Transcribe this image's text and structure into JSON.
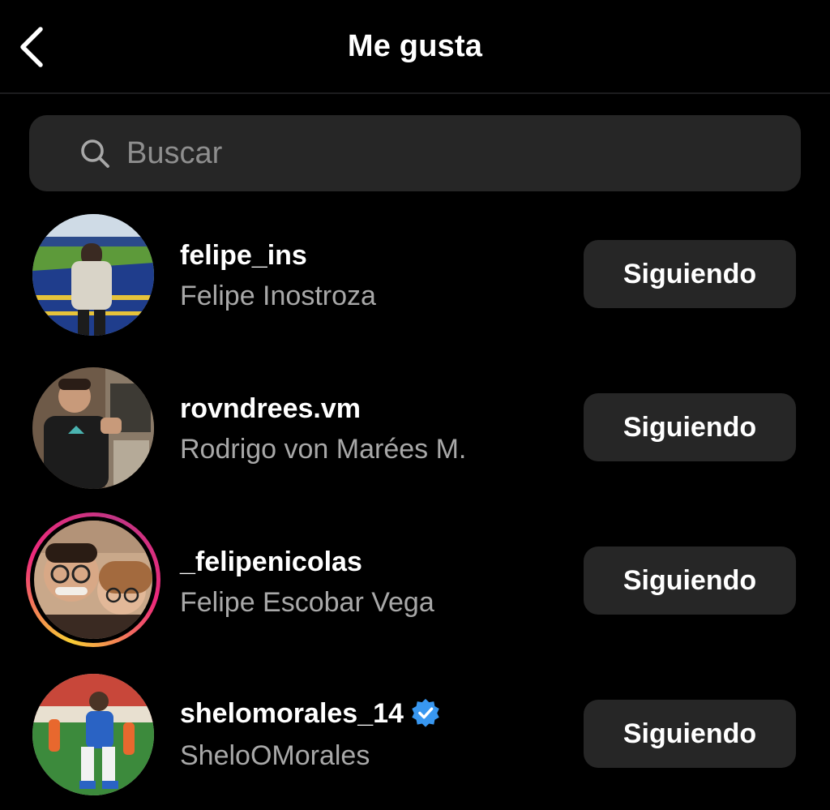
{
  "header": {
    "title": "Me gusta",
    "back_icon": "chevron-left-icon"
  },
  "search": {
    "placeholder": "Buscar",
    "value": "",
    "icon": "search-icon"
  },
  "colors": {
    "background": "#000000",
    "surface": "#262626",
    "secondary_text": "#a8a8a8",
    "verified": "#3897f0",
    "story_ring_start": "#f9ce34",
    "story_ring_mid": "#ee2a7b",
    "story_ring_end": "#6228d7"
  },
  "likes": [
    {
      "username": "felipe_ins",
      "full_name": "Felipe Inostroza",
      "verified": false,
      "story_ring": false,
      "button_label": "Siguiendo"
    },
    {
      "username": "rovndrees.vm",
      "full_name": "Rodrigo von Marées M.",
      "verified": false,
      "story_ring": false,
      "button_label": "Siguiendo"
    },
    {
      "username": "_felipenicolas",
      "full_name": "Felipe Escobar Vega",
      "verified": false,
      "story_ring": true,
      "button_label": "Siguiendo"
    },
    {
      "username": "shelomorales_14",
      "full_name": "SheloOMorales",
      "verified": true,
      "story_ring": false,
      "button_label": "Siguiendo"
    }
  ]
}
